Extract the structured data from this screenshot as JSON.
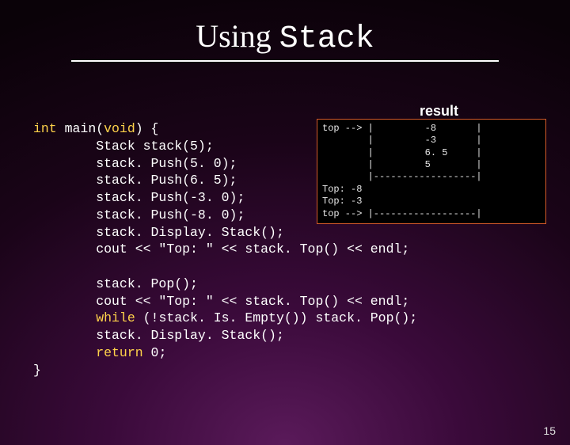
{
  "title": {
    "part1": "Using ",
    "part2": "Stack"
  },
  "result_label": "result",
  "code": {
    "l1a": "int",
    "l1b": " main(",
    "l1c": "void",
    "l1d": ") {",
    "l2": "        Stack stack(5);",
    "l3": "        stack. Push(5. 0);",
    "l4": "        stack. Push(6. 5);",
    "l5": "        stack. Push(-3. 0);",
    "l6": "        stack. Push(-8. 0);",
    "l7": "        stack. Display. Stack();",
    "l8": "        cout << \"Top: \" << stack. Top() << endl;",
    "blank1": "",
    "l9": "        stack. Pop();",
    "l10": "        cout << \"Top: \" << stack. Top() << endl;",
    "l11a": "        ",
    "l11b": "while",
    "l11c": " (!stack. Is. Empty()) stack. Pop();",
    "l12": "        stack. Display. Stack();",
    "l13a": "        ",
    "l13b": "return",
    "l13c": " 0;",
    "l14": "}"
  },
  "terminal": {
    "r1": "top --> |         -8       |",
    "r2": "        |         -3       |",
    "r3": "        |         6. 5     |",
    "r4": "        |         5        |",
    "r5": "        |------------------|",
    "r6": "Top: -8",
    "r7": "Top: -3",
    "r8": "top --> |------------------|"
  },
  "pagenum": "15"
}
